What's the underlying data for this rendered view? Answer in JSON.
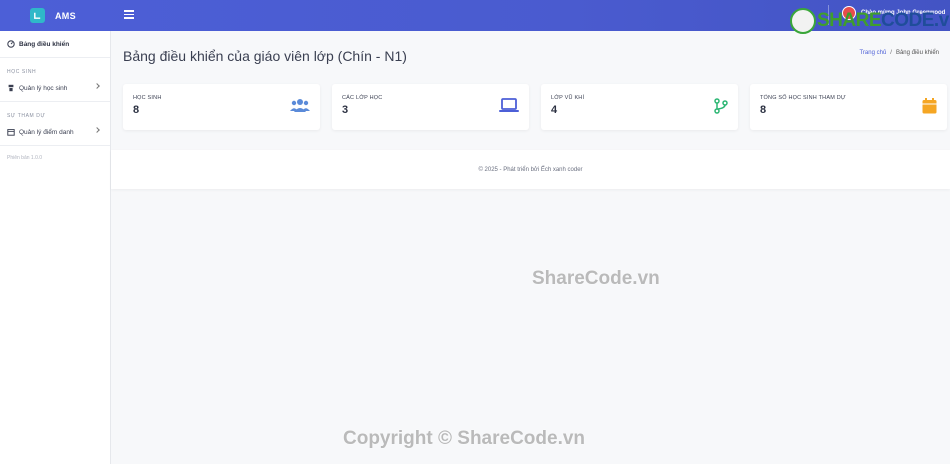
{
  "brand": {
    "name": "AMS"
  },
  "header": {
    "welcome": "Chào mừng John Greenwood"
  },
  "sidebar": {
    "dashboard": "Bảng điều khiển",
    "section_students": "HỌC SINH",
    "manage_students": "Quản lý học sinh",
    "section_attendance": "SỰ THAM DỰ",
    "manage_attendance": "Quản lý điểm danh",
    "version": "Phiên bản 1.0.0"
  },
  "main": {
    "title": "Bảng điều khiển của giáo viên lớp (Chín - N1)",
    "breadcrumb": {
      "home": "Trang chủ",
      "sep": "/",
      "current": "Bảng điều khiển"
    }
  },
  "cards": [
    {
      "label": "HỌC SINH",
      "value": "8",
      "icon": "users-icon",
      "color": "#5b8bd9"
    },
    {
      "label": "CÁC LỚP HỌC",
      "value": "3",
      "icon": "laptop-icon",
      "color": "#4c5fd7"
    },
    {
      "label": "LỚP VŨ KHÍ",
      "value": "4",
      "icon": "code-branch-icon",
      "color": "#2bb673"
    },
    {
      "label": "TỔNG SỐ HỌC SINH THAM DỰ",
      "value": "8",
      "icon": "calendar-icon",
      "color": "#f5a623"
    }
  ],
  "footer": {
    "text": "© 2025 - Phát triển bởi Ếch xanh coder"
  },
  "watermarks": {
    "center": "ShareCode.vn",
    "bottom": "Copyright © ShareCode.vn",
    "logo_a": "SHARE",
    "logo_b": "CODE.vn"
  }
}
